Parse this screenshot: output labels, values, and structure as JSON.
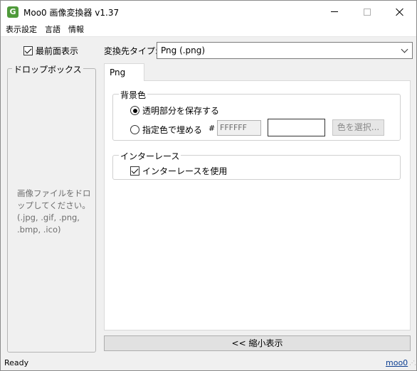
{
  "window": {
    "title": "Moo0 画像変換器 v1.37",
    "app_icon": "G",
    "accent": "#4f9a3a"
  },
  "menu": [
    "表示設定",
    "言語",
    "情報"
  ],
  "left": {
    "topmost_label": "最前面表示",
    "topmost_checked": true,
    "dropbox_title": "ドロップボックス",
    "dropbox_hint": "画像ファイルをドロップしてください。(.jpg, .gif, .png, .bmp, .ico)"
  },
  "right": {
    "target_label": "変換先タイプ:",
    "target_value": "Png (.png)",
    "tab_label": "Png",
    "bg": {
      "title": "背景色",
      "option_keep": "透明部分を保存する",
      "option_fill": "指定色で埋める",
      "hash": "#",
      "hex_value": "FFFFFF",
      "pick_button": "色を選択..."
    },
    "interlace": {
      "title": "インターレース",
      "use_label": "インターレースを使用",
      "checked": true
    },
    "shrink_button": "<< 縮小表示"
  },
  "status": {
    "text": "Ready",
    "link": "moo0"
  }
}
